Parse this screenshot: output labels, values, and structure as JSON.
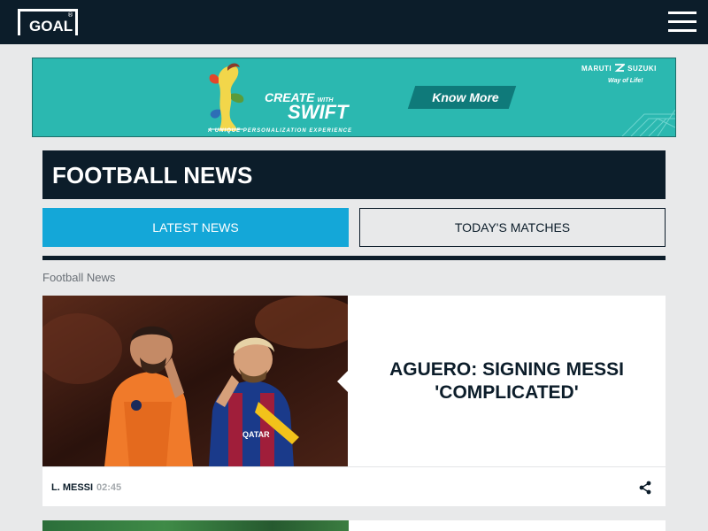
{
  "header": {
    "logo_text": "GOAL",
    "logo_registered": "®",
    "menu_icon": "hamburger-menu-icon"
  },
  "ad": {
    "headline_create": "CREATE",
    "headline_with": "WITH",
    "headline_swift": "SWIFT",
    "tagline": "A UNIQUE PERSONALIZATION EXPERIENCE",
    "cta_label": "Know More",
    "brand_left": "MARUTI",
    "brand_right": "SUZUKI",
    "slogan": "Way of Life!",
    "background_color": "#2bb8b0"
  },
  "section": {
    "title": "FOOTBALL NEWS"
  },
  "tabs": [
    {
      "label": "LATEST NEWS",
      "active": true
    },
    {
      "label": "TODAY'S MATCHES",
      "active": false
    }
  ],
  "breadcrumb": "Football News",
  "articles": [
    {
      "headline": "AGUERO: SIGNING MESSI 'COMPLICATED'",
      "tag": "L. MESSI",
      "time": "02:45",
      "share_icon": "share-icon",
      "image_icon": "article-photo"
    }
  ],
  "colors": {
    "navy": "#0c1d2a",
    "accent_blue": "#14a7d8",
    "background": "#e8e9ea"
  }
}
